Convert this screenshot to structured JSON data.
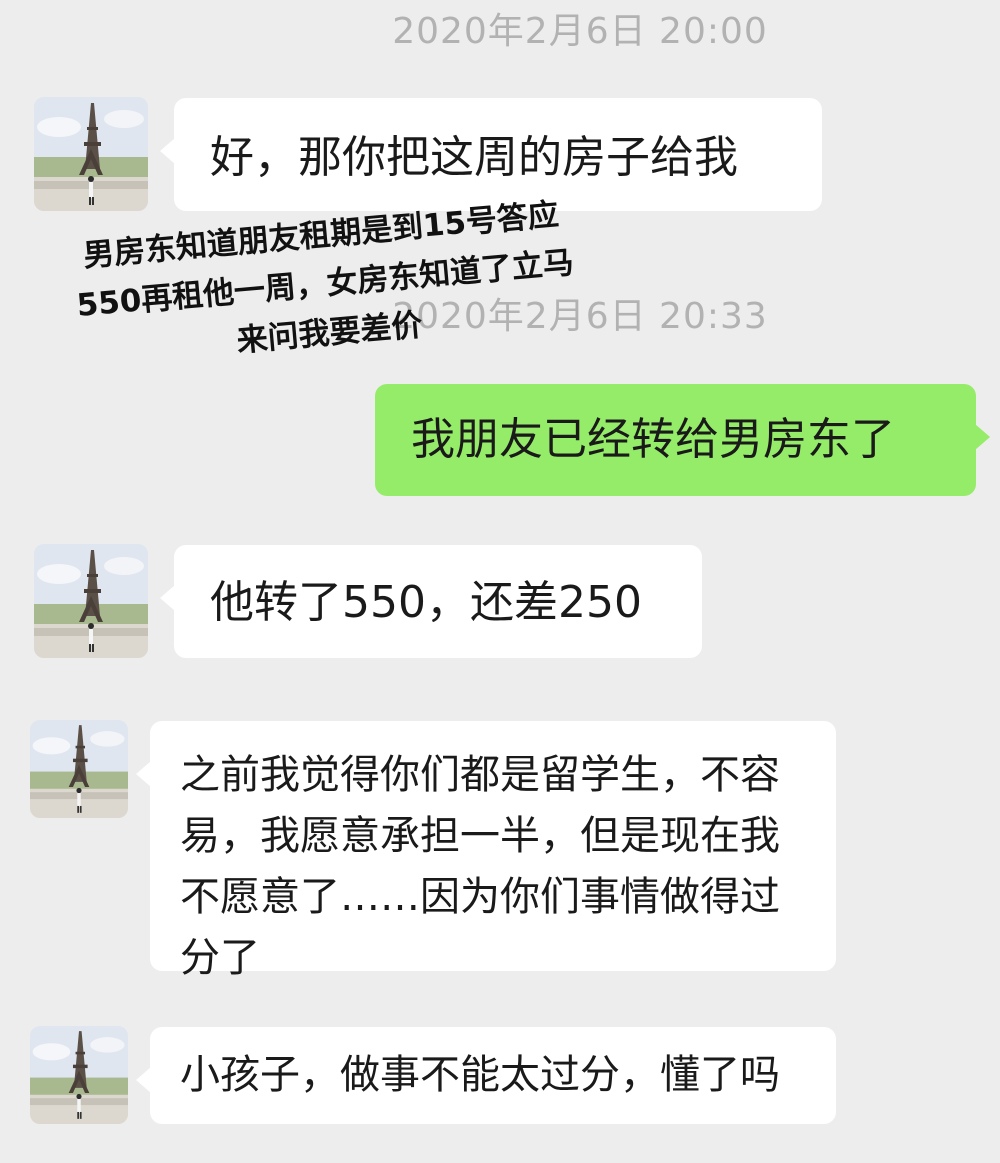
{
  "timestamps": {
    "first": "2020年2月6日 20:00",
    "second": "2020年2月6日 20:33"
  },
  "messages": [
    {
      "sender": "other",
      "text": "好，那你把这周的房子给我"
    },
    {
      "sender": "me",
      "text": "我朋友已经转给男房东了"
    },
    {
      "sender": "other",
      "text": "他转了550，还差250"
    },
    {
      "sender": "other",
      "lines": [
        "之前我觉得你们都是留学生，不容",
        "易，我愿意承担一半，但是现在我",
        "不愿意了……因为你们事情做得过",
        "分了"
      ]
    },
    {
      "sender": "other",
      "text": "小孩子，做事不能太过分，懂了吗"
    }
  ],
  "annotation": {
    "lines": [
      "男房东知道朋友租期是到15号答应",
      "550再租他一周，女房东知道了立马",
      "来问我要差价"
    ]
  },
  "colors": {
    "background": "#ededed",
    "my_bubble": "#95ec69",
    "other_bubble": "#ffffff",
    "timestamp": "#b2b2b2"
  }
}
